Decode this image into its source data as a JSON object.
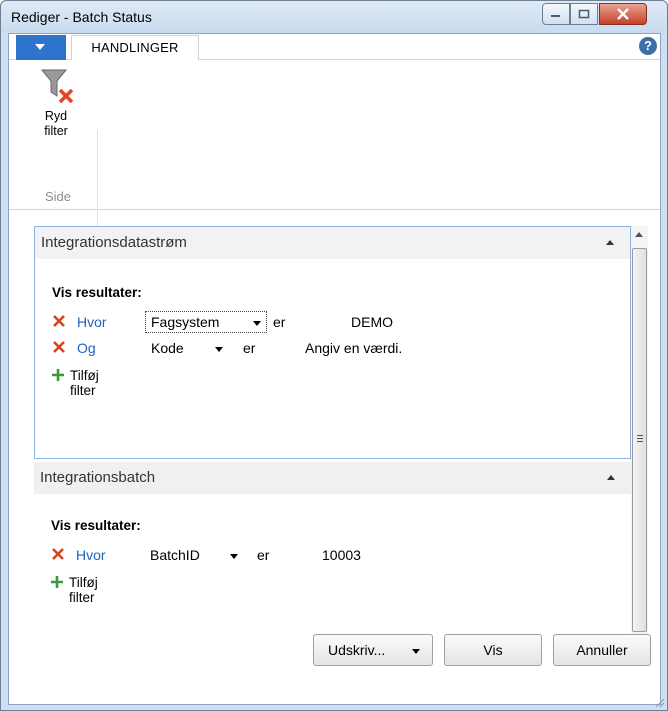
{
  "window": {
    "title": "Rediger - Batch Status"
  },
  "ribbon": {
    "tab_label": "HANDLINGER",
    "clear_filter_line1": "Ryd",
    "clear_filter_line2": "filter",
    "group_label": "Side"
  },
  "sections": [
    {
      "title": "Integrationsdatastrøm",
      "show_results_label": "Vis resultater:",
      "filters": [
        {
          "connector": "Hvor",
          "field": "Fagsystem",
          "operator": "er",
          "value": "DEMO"
        },
        {
          "connector": "Og",
          "field": "Kode",
          "operator": "er",
          "value": "Angiv en værdi."
        }
      ],
      "add_filter_label": "Tilføj filter"
    },
    {
      "title": "Integrationsbatch",
      "show_results_label": "Vis resultater:",
      "filters": [
        {
          "connector": "Hvor",
          "field": "BatchID",
          "operator": "er",
          "value": "10003"
        }
      ],
      "add_filter_label": "Tilføj filter"
    }
  ],
  "buttons": {
    "print": "Udskriv...",
    "show": "Vis",
    "cancel": "Annuller"
  },
  "colors": {
    "accent": "#2f74cc",
    "remove_icon": "#d9411e",
    "add_icon": "#3a9a3a",
    "connector_text": "#2060c0"
  }
}
